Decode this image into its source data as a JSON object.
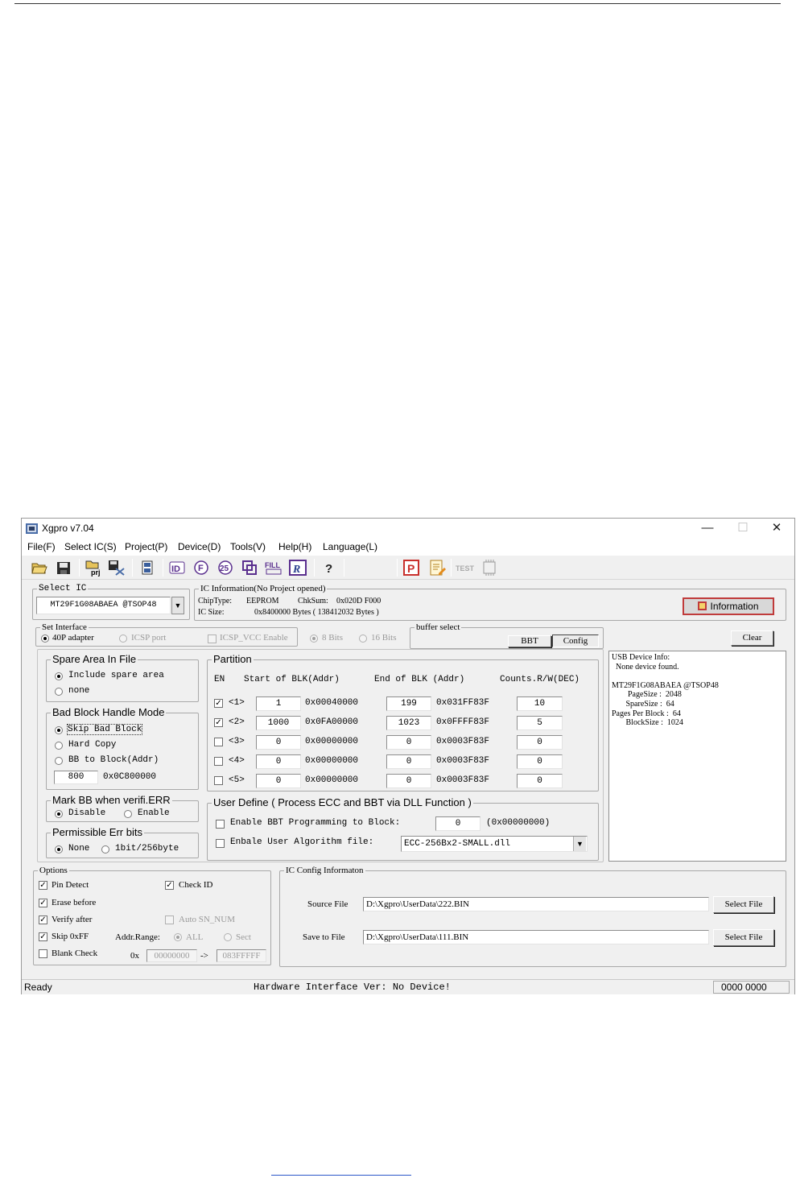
{
  "window": {
    "title": "Xgpro v7.04",
    "minimize": "—",
    "maximize": "☐",
    "close": "✕"
  },
  "menu": [
    "File(F)",
    "Select IC(S)",
    "Project(P)",
    "Device(D)",
    "Tools(V)",
    "Help(H)",
    "Language(L)"
  ],
  "toolbar": {
    "icons": [
      "open-folder-icon",
      "save-icon",
      "open-project-icon",
      "save-project-icon",
      "buffer-icon",
      "read-id-icon",
      "read-icon",
      "verify-icon",
      "program-icon",
      "fill-icon",
      "read-icon-r",
      "help-icon",
      "program-p-icon",
      "edit-icon",
      "test-icon",
      "chip-icon"
    ],
    "id_label": "ID",
    "fill_label": "FILL",
    "prj_label": "prj",
    "help_label": "?",
    "p_label": "P",
    "test_label": "TEST",
    "r_label": "R",
    "f_label": "F",
    "num_label": "25"
  },
  "select_ic": {
    "legend": "Select IC",
    "value": "MT29F1G08ABAEA @TSOP48"
  },
  "ic_info": {
    "legend": "IC Information(No Project opened)",
    "chip_type_label": "ChipType:",
    "chip_type": "EEPROM",
    "chksum_label": "ChkSum:",
    "chksum": "0x020D F000",
    "ic_size_label": "IC Size:",
    "ic_size": "0x8400000 Bytes ( 138412032 Bytes )",
    "information_button": "Information"
  },
  "interface": {
    "legend": "Set Interface",
    "adapter": "40P adapter",
    "icsp_port": "ICSP port",
    "icsp_vcc": "ICSP_VCC Enable",
    "bits8": "8 Bits",
    "bits16": "16 Bits"
  },
  "buffer_select": {
    "legend": "buffer select",
    "bbt": "BBT",
    "config": "Config"
  },
  "clear_button": "Clear",
  "usb_info": [
    "USB Device Info:",
    "  None device found.",
    "",
    "MT29F1G08ABAEA @TSOP48",
    "        PageSize :  2048",
    "       SpareSize :  64",
    "Pages Per Block :  64",
    "       BlockSize :  1024"
  ],
  "spare_area": {
    "legend": "Spare Area In File",
    "include": "Include spare area",
    "none": "none"
  },
  "bad_block": {
    "legend": "Bad Block Handle Mode",
    "skip": "Skip Bad Block",
    "hard": "Hard Copy",
    "bb_to_block": "BB to Block(Addr)",
    "block_value": "800",
    "block_addr": "0x0C800000"
  },
  "mark_bb": {
    "legend": "Mark BB when verifi.ERR",
    "disable": "Disable",
    "enable": "Enable"
  },
  "err_bits": {
    "legend": "Permissible Err bits",
    "none": "None",
    "bit": "1bit/256byte"
  },
  "partition": {
    "legend": "Partition",
    "headers": {
      "en": "EN",
      "start": "Start of BLK(Addr)",
      "end": "End of BLK (Addr)",
      "counts": "Counts.R/W(DEC)"
    },
    "rows": [
      {
        "label": "<1>",
        "checked": true,
        "start": "1",
        "start_addr": "0x00040000",
        "end": "199",
        "end_addr": "0x031FF83F",
        "count": "10"
      },
      {
        "label": "<2>",
        "checked": true,
        "start": "1000",
        "start_addr": "0x0FA00000",
        "end": "1023",
        "end_addr": "0x0FFFF83F",
        "count": "5"
      },
      {
        "label": "<3>",
        "checked": false,
        "start": "0",
        "start_addr": "0x00000000",
        "end": "0",
        "end_addr": "0x0003F83F",
        "count": "0"
      },
      {
        "label": "<4>",
        "checked": false,
        "start": "0",
        "start_addr": "0x00000000",
        "end": "0",
        "end_addr": "0x0003F83F",
        "count": "0"
      },
      {
        "label": "<5>",
        "checked": false,
        "start": "0",
        "start_addr": "0x00000000",
        "end": "0",
        "end_addr": "0x0003F83F",
        "count": "0"
      }
    ]
  },
  "user_define": {
    "legend": "User Define ( Process ECC and BBT via DLL Function )",
    "bbt_label": "Enable BBT Programming to Block:",
    "bbt_value": "0",
    "bbt_addr": "(0x00000000)",
    "algo_label": "Enbale User Algorithm file:",
    "algo_value": "ECC-256Bx2-SMALL.dll"
  },
  "options": {
    "legend": "Options",
    "pin_detect": "Pin Detect",
    "check_id": "Check ID",
    "erase_before": "Erase before",
    "auto_sn": "Auto SN_NUM",
    "verify_after": "Verify after",
    "skip_off": "Skip 0xFF",
    "addr_range": "Addr.Range:",
    "all": "ALL",
    "sect": "Sect",
    "blank_check": "Blank Check",
    "ox": "0x",
    "range_from": "00000000",
    "arrow": "->",
    "range_to": "083FFFFF"
  },
  "ic_config": {
    "legend": "IC Config Informaton",
    "source_label": "Source File",
    "source_value": "D:\\Xgpro\\UserData\\222.BIN",
    "save_label": "Save to File",
    "save_value": "D:\\Xgpro\\UserData\\111.BIN",
    "select_file": "Select File"
  },
  "status": {
    "ready": "Ready",
    "hardware": "Hardware Interface Ver: No Device!",
    "counter": "0000 0000"
  }
}
